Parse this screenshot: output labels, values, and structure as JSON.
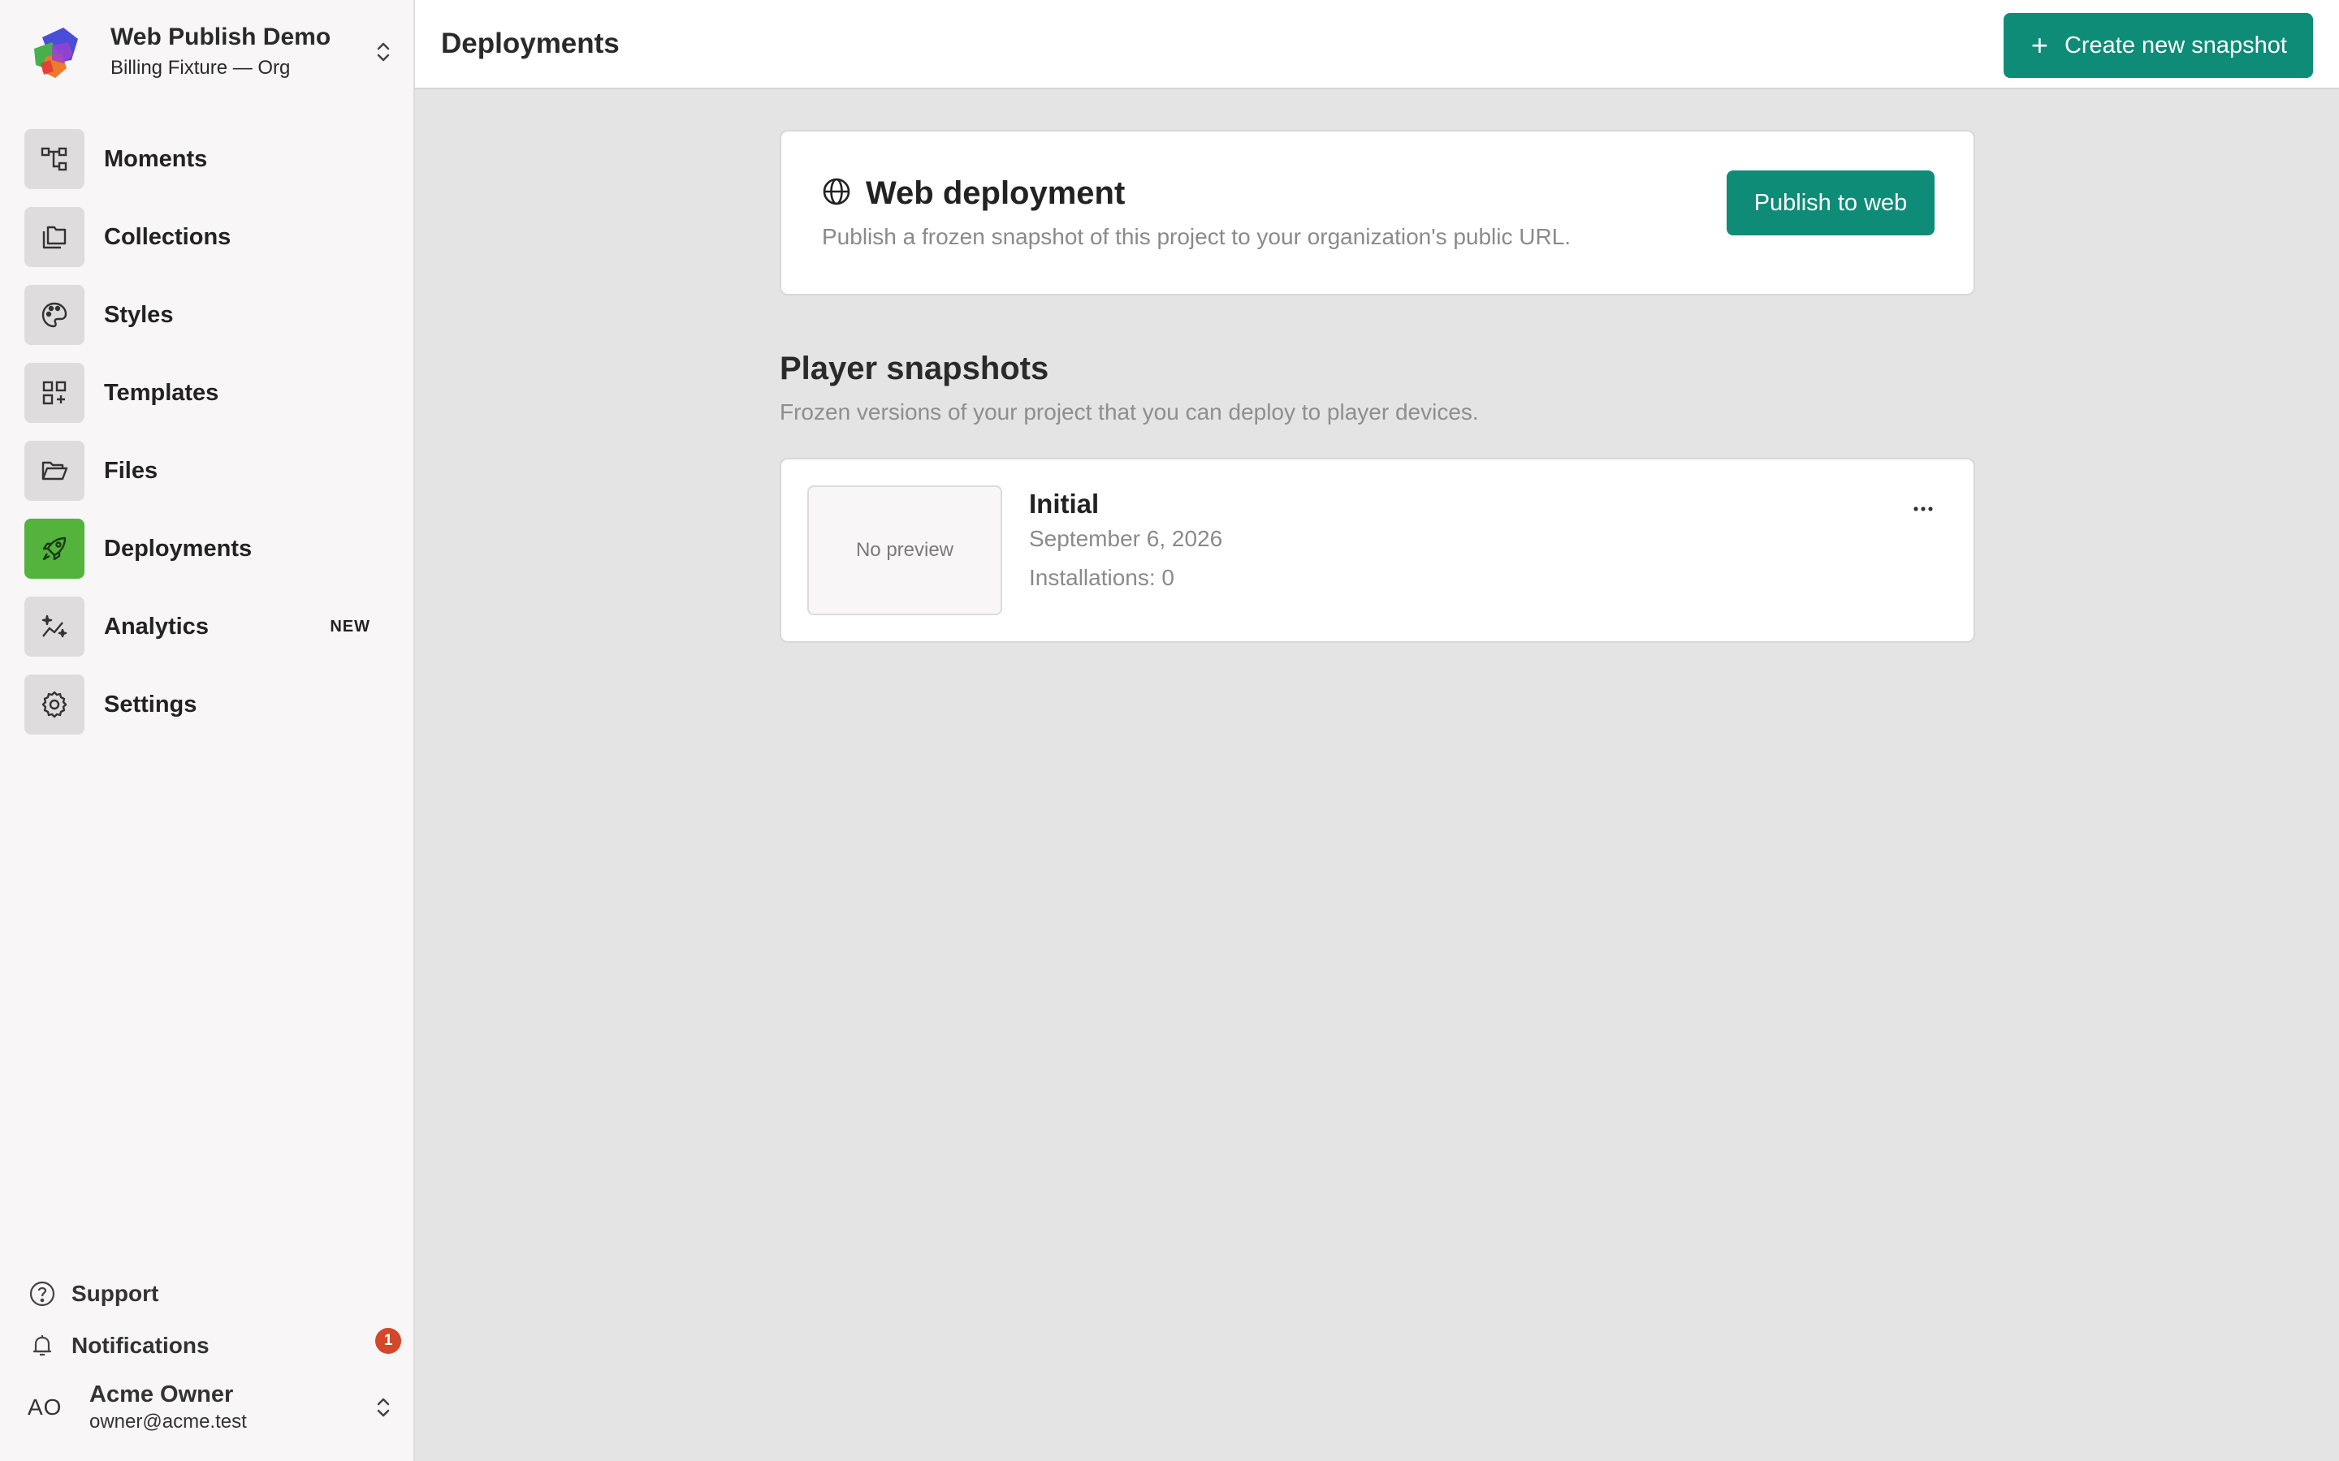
{
  "workspace": {
    "name": "Web Publish Demo",
    "org": "Billing Fixture — Org"
  },
  "sidebar": {
    "items": [
      {
        "label": "Moments",
        "icon": "tree-structure-icon"
      },
      {
        "label": "Collections",
        "icon": "collections-icon"
      },
      {
        "label": "Styles",
        "icon": "palette-icon"
      },
      {
        "label": "Templates",
        "icon": "templates-grid-icon"
      },
      {
        "label": "Files",
        "icon": "folder-open-icon"
      },
      {
        "label": "Deployments",
        "icon": "rocket-icon",
        "active": true
      },
      {
        "label": "Analytics",
        "icon": "sparkle-chart-icon",
        "badge": "NEW"
      },
      {
        "label": "Settings",
        "icon": "gear-icon"
      }
    ],
    "support_label": "Support",
    "notifications_label": "Notifications",
    "notifications_count": "1"
  },
  "user": {
    "initials": "AO",
    "name": "Acme Owner",
    "email": "owner@acme.test"
  },
  "header": {
    "title": "Deployments",
    "create_button_label": "Create new snapshot"
  },
  "web_deployment": {
    "title": "Web deployment",
    "description": "Publish a frozen snapshot of this project to your organization's public URL.",
    "publish_button_label": "Publish to web"
  },
  "snapshots": {
    "heading": "Player snapshots",
    "subheading": "Frozen versions of your project that you can deploy to player devices.",
    "items": [
      {
        "preview_text": "No preview",
        "name": "Initial",
        "date": "September 6, 2026",
        "installations": "Installations: 0"
      }
    ]
  },
  "colors": {
    "accent": "#0e8c77",
    "active_nav": "#53b33d",
    "notification_badge": "#d2482b"
  }
}
